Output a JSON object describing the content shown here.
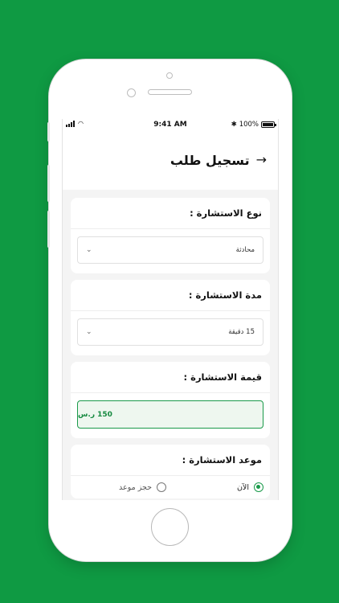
{
  "status_bar": {
    "time": "9:41 AM",
    "battery_text": "100%",
    "bluetooth_icon": "bluetooth-icon",
    "wifi_icon": "wifi-icon"
  },
  "header": {
    "title": "تسجيل طلب",
    "back_icon": "arrow-right-icon"
  },
  "form": {
    "consultation_type": {
      "label": "نوع الاستشارة :",
      "selected": "محادثة"
    },
    "consultation_duration": {
      "label": "مدة الاستشارة :",
      "selected": "15 دقيقة"
    },
    "consultation_price": {
      "label": "قيمة الاستشارة :",
      "value": "150 ر.س"
    },
    "consultation_time": {
      "label": "موعد الاستشارة :",
      "options": [
        "الآن",
        "حجز موعد"
      ],
      "selected_index": 0
    }
  },
  "colors": {
    "background": "#0f9a43",
    "accent": "#1a9a4a",
    "price_fill": "#eef7ef"
  }
}
